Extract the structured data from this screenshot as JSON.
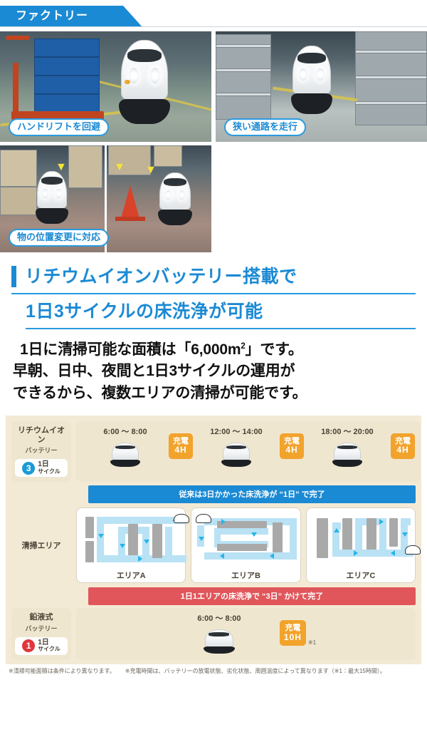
{
  "header": {
    "title": "ファクトリー"
  },
  "photos": [
    {
      "caption": "ハンドリフトを回避",
      "alt_name": "photo-hand-lift-avoidance"
    },
    {
      "caption": "狭い通路を走行",
      "alt_name": "photo-narrow-aisle-driving"
    },
    {
      "caption": "物の位置変更に対応",
      "alt_name": "photo-object-relocation-response"
    }
  ],
  "heading": {
    "line1": "リチウムイオンバッテリー搭載で",
    "line2": "1日3サイクルの床洗浄が可能"
  },
  "body": {
    "line1_a": "1日に清掃可能な面積は「6,000m",
    "line1_sup": "2",
    "line1_b": "」です。",
    "line2": "早朝、日中、夜間と1日3サイクルの運用が",
    "line3": "できるから、複数エリアの清掃が可能です。"
  },
  "infographic": {
    "lithium": {
      "battery_name": "リチウムイオン",
      "battery_sub": "バッテリー",
      "cycle_count": "3",
      "cycle_day": "1日",
      "cycle_label": "サイクル",
      "slots": [
        {
          "time": "6:00 ～ 8:00",
          "charge_label": "充電",
          "charge_hours": "4H"
        },
        {
          "time": "12:00 ～ 14:00",
          "charge_label": "充電",
          "charge_hours": "4H"
        },
        {
          "time": "18:00 ～ 20:00",
          "charge_label": "充電",
          "charge_hours": "4H"
        }
      ],
      "summary_bar": "従来は3日かかった床洗浄が “1日” で完了"
    },
    "area_section": {
      "label": "清掃エリア",
      "areas": [
        {
          "name": "エリアA"
        },
        {
          "name": "エリアB"
        },
        {
          "name": "エリアC"
        }
      ]
    },
    "lead_acid": {
      "battery_name": "鉛液式",
      "battery_sub": "バッテリー",
      "cycle_count": "1",
      "cycle_day": "1日",
      "cycle_label": "サイクル",
      "summary_bar": "1日1エリアの床洗浄で “3日” かけて完了",
      "slot": {
        "time": "6:00 ～ 8:00",
        "charge_label": "充電",
        "charge_hours": "10H",
        "note_mark": "※1"
      }
    }
  },
  "footnotes": {
    "note1": "※清掃可能面積は条件により異なります。",
    "note2": "※充電時間は、バッテリーの放電状態、劣化状態、周囲温度によって異なります（※1：最大15時間）。"
  },
  "colors": {
    "brand_blue": "#1b8ad4",
    "accent_blue": "#2a9ae0",
    "charge_orange": "#f2a32c",
    "alert_red": "#e0565b",
    "cream": "#f3ead6"
  }
}
